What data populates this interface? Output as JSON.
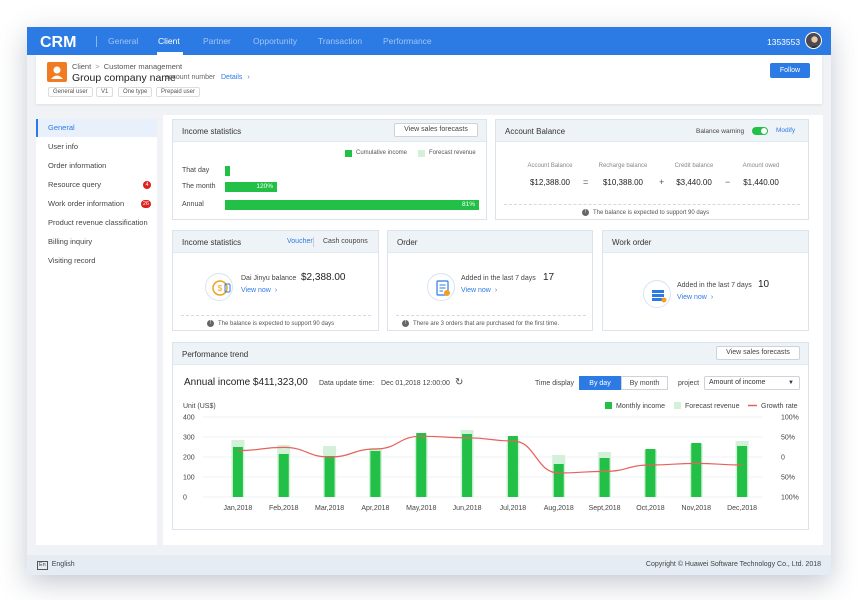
{
  "nav": {
    "logo": "CRM",
    "items": [
      "General",
      "Client",
      "Partner",
      "Opportunity",
      "Transaction",
      "Performance"
    ],
    "active": "Client",
    "user_id": "1353553"
  },
  "header": {
    "breadcrumb_root": "Client",
    "breadcrumb_sep": ">",
    "breadcrumb_current": "Customer management",
    "group_name": "Group company name",
    "account_number": "account number",
    "details": "Details",
    "tags": [
      "General user",
      "V1",
      "One type",
      "Prepaid user"
    ],
    "follow": "Follow"
  },
  "sidebar": {
    "items": [
      {
        "label": "General",
        "badge": ""
      },
      {
        "label": "User info",
        "badge": ""
      },
      {
        "label": "Order information",
        "badge": ""
      },
      {
        "label": "Resource query",
        "badge": "4"
      },
      {
        "label": "Work order information",
        "badge": "26"
      },
      {
        "label": "Product revenue classification",
        "badge": ""
      },
      {
        "label": "Billing inquiry",
        "badge": ""
      },
      {
        "label": "Visiting record",
        "badge": ""
      }
    ]
  },
  "income_stats": {
    "title": "Income statistics",
    "button": "View sales forecasts",
    "legend_cumulative": "Cumulative income",
    "legend_forecast": "Forecast revenue",
    "rows": [
      {
        "label": "That day",
        "value": "",
        "fraction": 0.015
      },
      {
        "label": "The month",
        "value": "120%",
        "fraction": 0.16
      },
      {
        "label": "Annual",
        "value": "81%",
        "fraction": 0.78
      }
    ]
  },
  "account_balance": {
    "title": "Account Balance",
    "warning_label": "Balance warning",
    "warning_on": true,
    "modify": "Modify",
    "items": [
      {
        "label": "Account Balance",
        "value": "$12,388.00"
      },
      {
        "label": "Recharge balance",
        "value": "$10,388.00"
      },
      {
        "label": "Credit balance",
        "value": "$3,440.00"
      },
      {
        "label": "Amount owed",
        "value": "$1,440.00"
      }
    ],
    "ops": [
      "=",
      "+",
      "−"
    ],
    "note": "The balance is expected to support 90 days"
  },
  "income_stats2": {
    "title": "Income statistics",
    "tab_voucher": "Voucher",
    "tab_cash": "Cash coupons",
    "balance_label": "Dai Jinyu balance",
    "balance_value": "$2,388.00",
    "view_now": "View now",
    "note": "The balance is expected to support 90 days"
  },
  "order": {
    "title": "Order",
    "added_label": "Added in the last 7 days",
    "count": "17",
    "view_now": "View now",
    "note": "There are 3 orders that are purchased for the first time."
  },
  "work_order": {
    "title": "Work order",
    "added_label": "Added in the last 7 days",
    "count": "10",
    "view_now": "View now"
  },
  "performance": {
    "title": "Performance trend",
    "button": "View sales forecasts",
    "annual_income": "Annual income $411,323,00",
    "update_label": "Data update time:",
    "update_time": "Dec 01,2018 12:00:00",
    "time_display": "Time display",
    "by_day": "By day",
    "by_month": "By month",
    "project_label": "project",
    "project_value": "Amount of income"
  },
  "chart_data": {
    "type": "bar",
    "ylabel": "Unit (US$)",
    "ylim": [
      0,
      400
    ],
    "yticks": [
      "400",
      "300",
      "200",
      "100",
      "0"
    ],
    "y2ticks": [
      "100%",
      "50%",
      "0",
      "50%",
      "100%"
    ],
    "categories": [
      "Jan,2018",
      "Feb,2018",
      "Mar,2018",
      "Apr,2018",
      "May,2018",
      "Jun,2018",
      "Jul,2018",
      "Aug,2018",
      "Sept,2018",
      "Oct,2018",
      "Nov,2018",
      "Dec,2018"
    ],
    "series": [
      {
        "name": "Monthly income",
        "values": [
          250,
          215,
          205,
          230,
          320,
          315,
          305,
          165,
          195,
          240,
          270,
          255
        ]
      },
      {
        "name": "Forecast revenue",
        "values": [
          285,
          260,
          255,
          245,
          300,
          335,
          290,
          210,
          225,
          235,
          265,
          280
        ]
      },
      {
        "name": "Growth rate",
        "values": [
          58,
          62,
          50,
          60,
          76,
          74,
          70,
          30,
          32,
          40,
          42,
          40
        ]
      }
    ],
    "colors": {
      "monthly": "#22c046",
      "forecast": "#d3f1d9",
      "growth": "#e8605c"
    },
    "legend": "top-right",
    "grid": true
  }
}
